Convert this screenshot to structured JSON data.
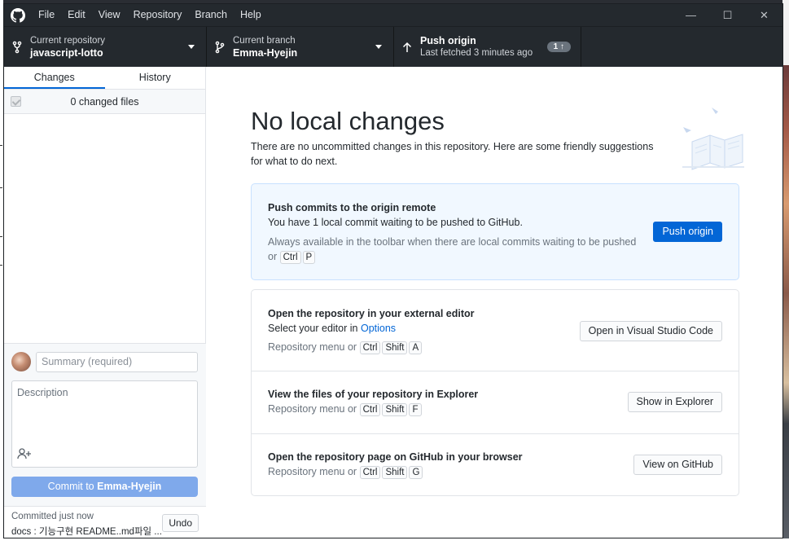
{
  "menu": [
    "File",
    "Edit",
    "View",
    "Repository",
    "Branch",
    "Help"
  ],
  "window_controls": {
    "minimize": "—",
    "maximize": "☐",
    "close": "✕"
  },
  "toolbar": {
    "repo": {
      "label": "Current repository",
      "value": "javascript-lotto"
    },
    "branch": {
      "label": "Current branch",
      "value": "Emma-Hyejin"
    },
    "push": {
      "label": "Push origin",
      "value": "Last fetched 3 minutes ago",
      "badge": "1 ↑"
    }
  },
  "sidebar": {
    "tabs": [
      "Changes",
      "History"
    ],
    "changed_files": "0 changed files",
    "summary_placeholder": "Summary (required)",
    "description_placeholder": "Description",
    "commit_prefix": "Commit to",
    "commit_branch": "Emma-Hyejin",
    "last_commit_time": "Committed just now",
    "last_commit_msg": "docs : 기능구현 README..md파일 ...",
    "undo": "Undo"
  },
  "main": {
    "title": "No local changes",
    "subtitle": "There are no uncommitted changes in this repository. Here are some friendly suggestions for what to do next.",
    "push_card": {
      "heading": "Push commits to the origin remote",
      "sub": "You have 1 local commit waiting to be pushed to GitHub.",
      "hint": "Always available in the toolbar when there are local commits waiting to be pushed or",
      "keys": [
        "Ctrl",
        "P"
      ],
      "button": "Push origin"
    },
    "editor_card": {
      "heading": "Open the repository in your external editor",
      "sub_prefix": "Select your editor in",
      "sub_link": "Options",
      "hint": "Repository menu or",
      "keys": [
        "Ctrl",
        "Shift",
        "A"
      ],
      "button": "Open in Visual Studio Code"
    },
    "explorer_card": {
      "heading": "View the files of your repository in Explorer",
      "hint": "Repository menu or",
      "keys": [
        "Ctrl",
        "Shift",
        "F"
      ],
      "button": "Show in Explorer"
    },
    "github_card": {
      "heading": "Open the repository page on GitHub in your browser",
      "hint": "Repository menu or",
      "keys": [
        "Ctrl",
        "Shift",
        "G"
      ],
      "button": "View on GitHub"
    }
  },
  "colors": {
    "accent": "#0366d6",
    "chrome": "#24292e",
    "commit_button_disabled": "#7fa9eb"
  },
  "icons": [
    "github-logo-icon",
    "repo-icon",
    "branch-icon",
    "arrow-up-icon",
    "co-author-icon",
    "caret-down-icon",
    "empty-state-illustration"
  ]
}
